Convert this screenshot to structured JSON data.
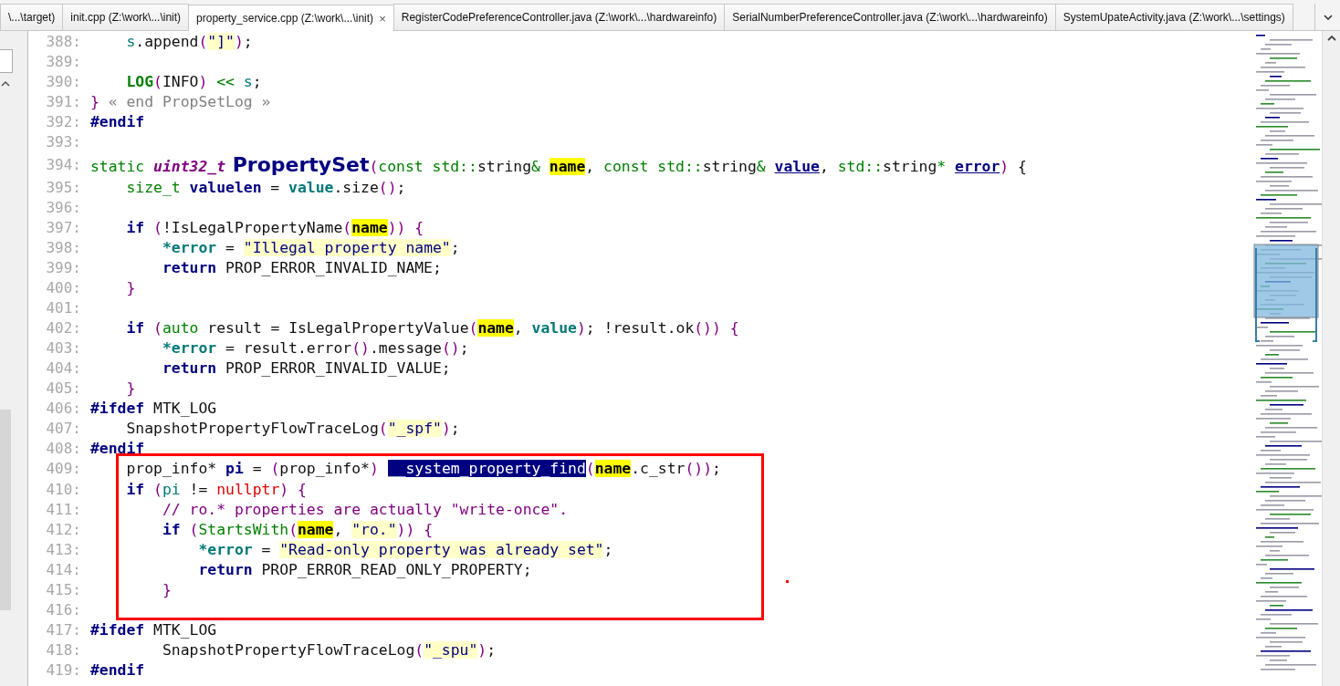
{
  "tabs": [
    {
      "label": "\\...\\target)",
      "selected": false,
      "closable": false
    },
    {
      "label": "init.cpp (Z:\\work\\...\\init)",
      "selected": false,
      "closable": false
    },
    {
      "label": "property_service.cpp (Z:\\work\\...\\init)",
      "selected": true,
      "closable": true,
      "close": "×"
    },
    {
      "label": "RegisterCodePreferenceController.java (Z:\\work\\...\\hardwareinfo)",
      "selected": false,
      "closable": false
    },
    {
      "label": "SerialNumberPreferenceController.java (Z:\\work\\...\\hardwareinfo)",
      "selected": false,
      "closable": false
    },
    {
      "label": "SystemUpateActivity.java (Z:\\work\\...\\settings)",
      "selected": false,
      "closable": false
    }
  ],
  "lines": [
    {
      "number": "388:",
      "tokens": [
        {
          "kind": "ident",
          "text": "    s"
        },
        {
          "kind": "plain",
          "text": ".append"
        },
        {
          "kind": "paren",
          "text": "("
        },
        {
          "kind": "str",
          "text": "\"]\""
        },
        {
          "kind": "paren",
          "text": ")"
        },
        {
          "kind": "plain",
          "text": ";"
        }
      ]
    },
    {
      "number": "389:"
    },
    {
      "number": "390:",
      "tokens": [
        {
          "kind": "kwb",
          "text": "    LOG"
        },
        {
          "kind": "paren",
          "text": "("
        },
        {
          "kind": "plain",
          "text": "INFO"
        },
        {
          "kind": "paren",
          "text": ")"
        },
        {
          "kind": "kw",
          "text": " << "
        },
        {
          "kind": "ident",
          "text": "s"
        },
        {
          "kind": "plain",
          "text": ";"
        }
      ]
    },
    {
      "number": "391:",
      "tokens": [
        {
          "kind": "paren",
          "text": "}"
        },
        {
          "kind": "fold",
          "text": " « end PropSetLog »"
        }
      ]
    },
    {
      "number": "392:",
      "tokens": [
        {
          "kind": "bold",
          "text": "#endif"
        }
      ]
    },
    {
      "number": "393:"
    },
    {
      "number": "394:",
      "tokens": [
        {
          "kind": "kw",
          "text": "static "
        },
        {
          "kind": "type",
          "text": "uint32_t"
        },
        {
          "kind": "func",
          "text": " PropertySet"
        },
        {
          "kind": "paren",
          "text": "("
        },
        {
          "kind": "kw",
          "text": "const std::"
        },
        {
          "kind": "plain",
          "text": "string"
        },
        {
          "kind": "kw",
          "text": "& "
        },
        {
          "kind": "hl",
          "text": "name"
        },
        {
          "kind": "plain",
          "text": ", "
        },
        {
          "kind": "kw",
          "text": "const std::"
        },
        {
          "kind": "plain",
          "text": "string"
        },
        {
          "kind": "kw",
          "text": "& "
        },
        {
          "kind": "param",
          "text": "value"
        },
        {
          "kind": "plain",
          "text": ", "
        },
        {
          "kind": "kw",
          "text": "std::"
        },
        {
          "kind": "plain",
          "text": "string"
        },
        {
          "kind": "kw",
          "text": "* "
        },
        {
          "kind": "param",
          "text": "error"
        },
        {
          "kind": "paren",
          "text": ")"
        },
        {
          "kind": "plain",
          "text": " {"
        }
      ]
    },
    {
      "number": "395:",
      "tokens": [
        {
          "kind": "kw",
          "text": "    size_t"
        },
        {
          "kind": "bold",
          "text": " valuelen"
        },
        {
          "kind": "plain",
          "text": " = "
        },
        {
          "kind": "var",
          "text": "value"
        },
        {
          "kind": "plain",
          "text": ".size"
        },
        {
          "kind": "paren",
          "text": "()"
        },
        {
          "kind": "plain",
          "text": ";"
        }
      ]
    },
    {
      "number": "396:"
    },
    {
      "number": "397:",
      "tokens": [
        {
          "kind": "bold",
          "text": "    if"
        },
        {
          "kind": "paren",
          "text": " ("
        },
        {
          "kind": "plain",
          "text": "!IsLegalPropertyName"
        },
        {
          "kind": "paren",
          "text": "("
        },
        {
          "kind": "hl",
          "text": "name"
        },
        {
          "kind": "paren",
          "text": ")) {"
        }
      ]
    },
    {
      "number": "398:",
      "tokens": [
        {
          "kind": "var",
          "text": "        *error"
        },
        {
          "kind": "plain",
          "text": " = "
        },
        {
          "kind": "str",
          "text": "\"Illegal property name\""
        },
        {
          "kind": "plain",
          "text": ";"
        }
      ]
    },
    {
      "number": "399:",
      "tokens": [
        {
          "kind": "bold",
          "text": "        return"
        },
        {
          "kind": "plain",
          "text": " PROP_ERROR_INVALID_NAME;"
        }
      ]
    },
    {
      "number": "400:",
      "tokens": [
        {
          "kind": "paren",
          "text": "    }"
        }
      ]
    },
    {
      "number": "401:"
    },
    {
      "number": "402:",
      "tokens": [
        {
          "kind": "bold",
          "text": "    if"
        },
        {
          "kind": "paren",
          "text": " ("
        },
        {
          "kind": "kw",
          "text": "auto"
        },
        {
          "kind": "plain",
          "text": " result = IsLegalPropertyValue"
        },
        {
          "kind": "paren",
          "text": "("
        },
        {
          "kind": "hl",
          "text": "name"
        },
        {
          "kind": "plain",
          "text": ", "
        },
        {
          "kind": "var",
          "text": "value"
        },
        {
          "kind": "paren",
          "text": ")"
        },
        {
          "kind": "plain",
          "text": "; !result.ok"
        },
        {
          "kind": "paren",
          "text": "()) {"
        }
      ]
    },
    {
      "number": "403:",
      "tokens": [
        {
          "kind": "var",
          "text": "        *error"
        },
        {
          "kind": "plain",
          "text": " = result.error"
        },
        {
          "kind": "paren",
          "text": "()"
        },
        {
          "kind": "plain",
          "text": ".message"
        },
        {
          "kind": "paren",
          "text": "()"
        },
        {
          "kind": "plain",
          "text": ";"
        }
      ]
    },
    {
      "number": "404:",
      "tokens": [
        {
          "kind": "bold",
          "text": "        return"
        },
        {
          "kind": "plain",
          "text": " PROP_ERROR_INVALID_VALUE;"
        }
      ]
    },
    {
      "number": "405:",
      "tokens": [
        {
          "kind": "paren",
          "text": "    }"
        }
      ]
    },
    {
      "number": "406:",
      "tokens": [
        {
          "kind": "bold",
          "text": "#ifdef"
        },
        {
          "kind": "plain",
          "text": " MTK_LOG"
        }
      ]
    },
    {
      "number": "407:",
      "tokens": [
        {
          "kind": "plain",
          "text": "    SnapshotPropertyFlowTraceLog"
        },
        {
          "kind": "paren",
          "text": "("
        },
        {
          "kind": "str",
          "text": "\"_spf\""
        },
        {
          "kind": "paren",
          "text": ")"
        },
        {
          "kind": "plain",
          "text": ";"
        }
      ]
    },
    {
      "number": "408:",
      "tokens": [
        {
          "kind": "bold",
          "text": "#endif"
        }
      ]
    },
    {
      "number": "409:",
      "tokens": [
        {
          "kind": "plain",
          "text": "    prop_info* "
        },
        {
          "kind": "bold",
          "text": "pi"
        },
        {
          "kind": "plain",
          "text": " = "
        },
        {
          "kind": "paren",
          "text": "("
        },
        {
          "kind": "plain",
          "text": "prop_info*"
        },
        {
          "kind": "paren",
          "text": ") "
        },
        {
          "kind": "sel",
          "text": "__system_property_find"
        },
        {
          "kind": "paren",
          "text": "("
        },
        {
          "kind": "hl",
          "text": "name"
        },
        {
          "kind": "plain",
          "text": ".c_str"
        },
        {
          "kind": "paren",
          "text": "())"
        },
        {
          "kind": "plain",
          "text": ";"
        }
      ]
    },
    {
      "number": "410:",
      "tokens": [
        {
          "kind": "bold",
          "text": "    if"
        },
        {
          "kind": "paren",
          "text": " ("
        },
        {
          "kind": "ident",
          "text": "pi"
        },
        {
          "kind": "plain",
          "text": " != "
        },
        {
          "kind": "null",
          "text": "nullptr"
        },
        {
          "kind": "paren",
          "text": ") {"
        }
      ]
    },
    {
      "number": "411:",
      "tokens": [
        {
          "kind": "comment",
          "text": "        // ro.* properties are actually \"write-once\"."
        }
      ]
    },
    {
      "number": "412:",
      "tokens": [
        {
          "kind": "bold",
          "text": "        if"
        },
        {
          "kind": "paren",
          "text": " ("
        },
        {
          "kind": "kw",
          "text": "StartsWith"
        },
        {
          "kind": "paren",
          "text": "("
        },
        {
          "kind": "hl",
          "text": "name"
        },
        {
          "kind": "plain",
          "text": ", "
        },
        {
          "kind": "str",
          "text": "\"ro.\""
        },
        {
          "kind": "paren",
          "text": ")) {"
        }
      ]
    },
    {
      "number": "413:",
      "tokens": [
        {
          "kind": "var",
          "text": "            *error"
        },
        {
          "kind": "plain",
          "text": " = "
        },
        {
          "kind": "str",
          "text": "\"Read-only property was already set\""
        },
        {
          "kind": "plain",
          "text": ";"
        }
      ]
    },
    {
      "number": "414:",
      "tokens": [
        {
          "kind": "bold",
          "text": "            return"
        },
        {
          "kind": "plain",
          "text": " PROP_ERROR_READ_ONLY_PROPERTY;"
        }
      ]
    },
    {
      "number": "415:",
      "tokens": [
        {
          "kind": "paren",
          "text": "        }"
        }
      ]
    },
    {
      "number": "416:"
    },
    {
      "number": "417:",
      "tokens": [
        {
          "kind": "bold",
          "text": "#ifdef"
        },
        {
          "kind": "plain",
          "text": " MTK_LOG"
        }
      ]
    },
    {
      "number": "418:",
      "tokens": [
        {
          "kind": "plain",
          "text": "        SnapshotPropertyFlowTraceLog"
        },
        {
          "kind": "paren",
          "text": "("
        },
        {
          "kind": "str",
          "text": "\"_spu\""
        },
        {
          "kind": "paren",
          "text": ")"
        },
        {
          "kind": "plain",
          "text": ";"
        }
      ]
    },
    {
      "number": "419:",
      "tokens": [
        {
          "kind": "bold",
          "text": "#endif"
        }
      ]
    }
  ]
}
